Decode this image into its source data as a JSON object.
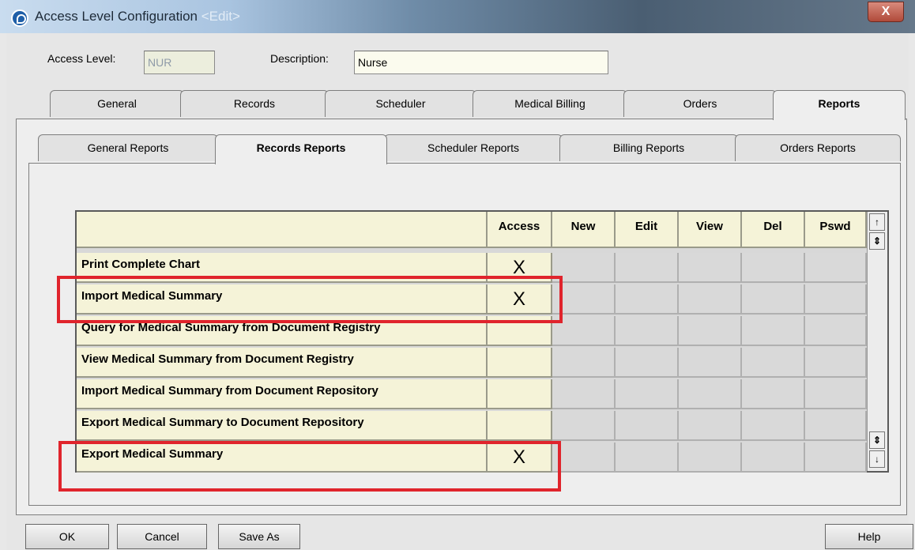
{
  "window": {
    "title": "Access Level Configuration",
    "title_suffix": "<Edit>",
    "close_glyph": "X"
  },
  "header": {
    "access_level_label": "Access Level:",
    "access_level_value": "NUR",
    "description_label": "Description:",
    "description_value": "Nurse"
  },
  "main_tabs": [
    {
      "label": "General",
      "active": false
    },
    {
      "label": "Records",
      "active": false
    },
    {
      "label": "Scheduler",
      "active": false
    },
    {
      "label": "Medical Billing",
      "active": false
    },
    {
      "label": "Orders",
      "active": false
    },
    {
      "label": "Reports",
      "active": true
    }
  ],
  "sub_tabs": [
    {
      "label": "General Reports",
      "active": false
    },
    {
      "label": "Records Reports",
      "active": true
    },
    {
      "label": "Scheduler Reports",
      "active": false
    },
    {
      "label": "Billing Reports",
      "active": false
    },
    {
      "label": "Orders Reports",
      "active": false
    }
  ],
  "grid": {
    "columns": [
      "Access",
      "New",
      "Edit",
      "View",
      "Del",
      "Pswd"
    ],
    "rows": [
      {
        "name": "Print Complete Chart",
        "access": "X"
      },
      {
        "name": "Import Medical Summary",
        "access": "X"
      },
      {
        "name": "Query for Medical Summary from Document Registry",
        "access": ""
      },
      {
        "name": "View Medical Summary from Document Registry",
        "access": ""
      },
      {
        "name": "Import Medical Summary from Document Repository",
        "access": ""
      },
      {
        "name": "Export Medical Summary to Document Repository",
        "access": ""
      },
      {
        "name": "Export Medical Summary",
        "access": "X"
      }
    ]
  },
  "buttons": {
    "ok": "OK",
    "cancel": "Cancel",
    "save_as": "Save As",
    "help": "Help"
  },
  "colors": {
    "highlight": "#e0242c",
    "cell_bg": "#f5f3d8"
  }
}
